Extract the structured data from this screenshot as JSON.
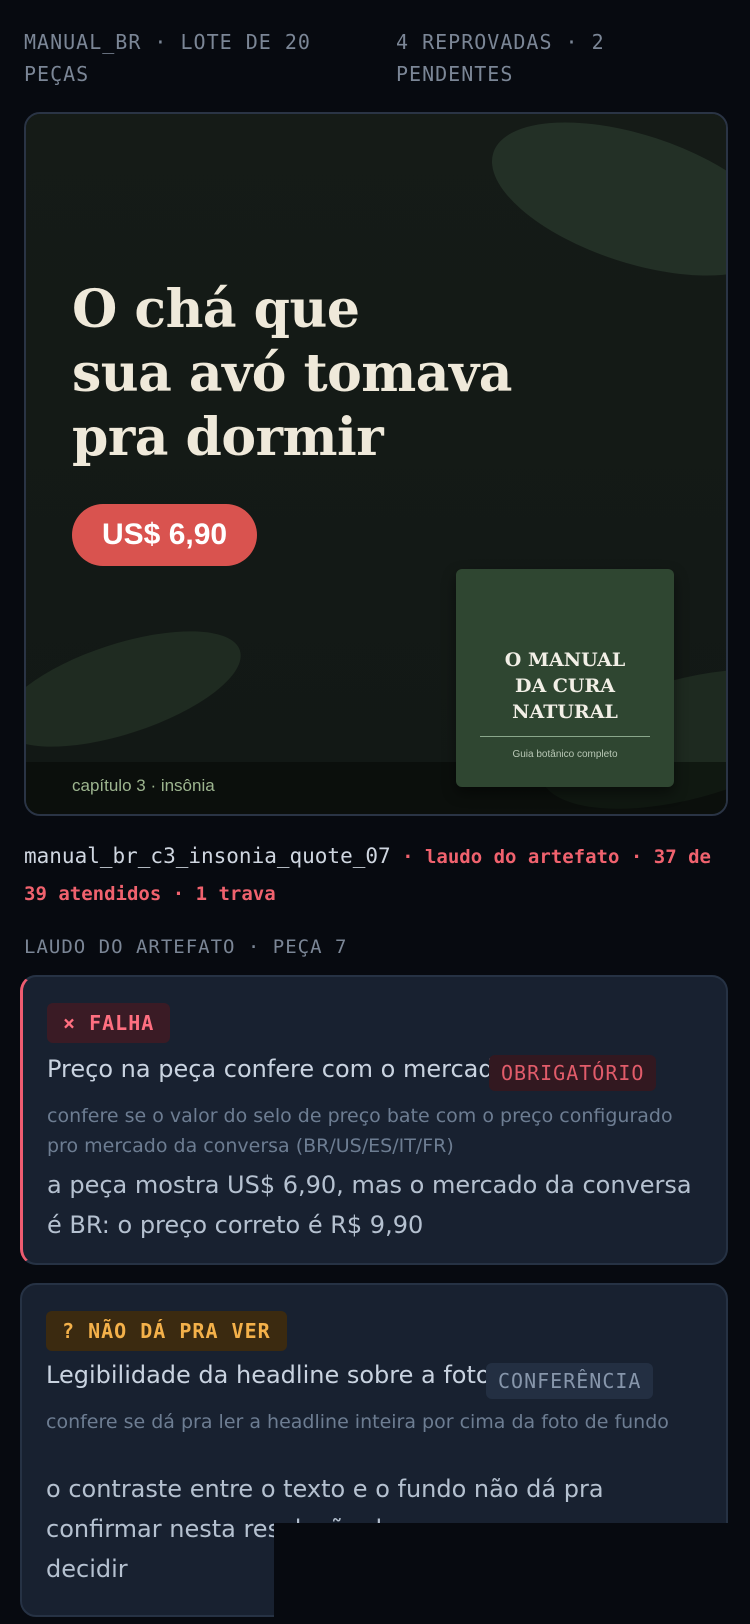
{
  "header": {
    "left": "MANUAL_BR · LOTE DE 20 PEÇAS",
    "right": "4 REPROVADAS · 2 PENDENTES"
  },
  "preview": {
    "headline": "O chá que\nsua avó tomava\npra dormir",
    "price": "US$ 6,90",
    "book_title": "O MANUAL\nDA CURA\nNATURAL",
    "book_subtitle": "Guia botânico completo",
    "chapter": "capítulo 3 · insônia",
    "colors": {
      "price_badge": "#d9534f",
      "book": "#2f4631",
      "headline": "#efe9da"
    }
  },
  "artifact": {
    "filename": "manual_br_c3_insonia_quote_07",
    "meta": " · laudo do artefato · 37 de 39 atendidos · 1 trava"
  },
  "section_label": "LAUDO DO ARTEFATO · PEÇA 7",
  "checks": [
    {
      "status": "× FALHA",
      "title": "Preço na peça confere com o mercado",
      "tag": "OBRIGATÓRIO",
      "description": "confere se o valor do selo de preço bate com o preço configurado pro mercado da conversa (BR/US/ES/IT/FR)",
      "result": "a peça mostra US$ 6,90, mas o mercado da conversa é BR: o preço correto é R$ 9,90",
      "accent": "#ee5c70"
    },
    {
      "status": "? NÃO DÁ PRA VER",
      "title": "Legibilidade da headline sobre a foto",
      "tag": "CONFERÊNCIA",
      "description": "confere se dá pra ler a headline inteira por cima da foto de fundo",
      "result": "o contraste entre o texto e o fundo não dá pra confirmar nesta resolução de p",
      "result_tail": "decidir",
      "accent": "#f4b14a"
    }
  ]
}
